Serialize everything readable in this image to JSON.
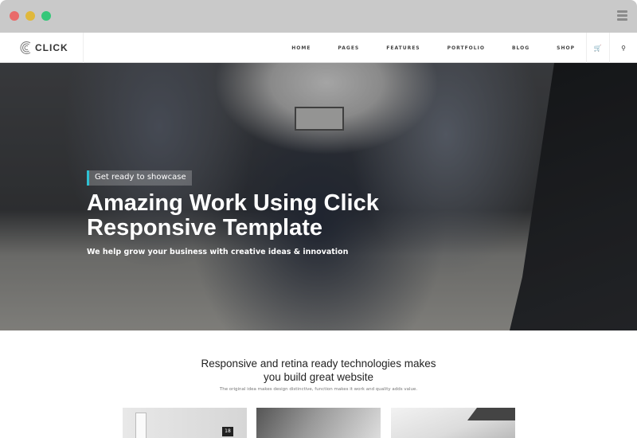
{
  "window": {
    "controls": [
      "close",
      "minimize",
      "maximize"
    ],
    "colors": {
      "close": "#e96b6a",
      "minimize": "#e0b83c",
      "maximize": "#36c77a"
    }
  },
  "nav": {
    "logo": "CLICK",
    "items": [
      "HOME",
      "PAGES",
      "FEATURES",
      "PORTFOLIO",
      "BLOG",
      "SHOP"
    ],
    "cart_icon": "cart-icon",
    "search_icon": "search-icon"
  },
  "hero": {
    "tag": "Get ready to showcase",
    "title_line1": "Amazing Work Using Click",
    "title_line2": "Responsive Template",
    "subtitle": "We help grow your business with creative ideas & innovation",
    "accent": "#2ec1d3"
  },
  "section": {
    "title_line1": "Responsive and retina ready technologies makes",
    "title_line2": "you build great website",
    "subtitle": "The original idea makes design distinctive, function makes it work and quality adds value."
  },
  "cards": [
    {
      "badge": "18"
    },
    {},
    {}
  ]
}
